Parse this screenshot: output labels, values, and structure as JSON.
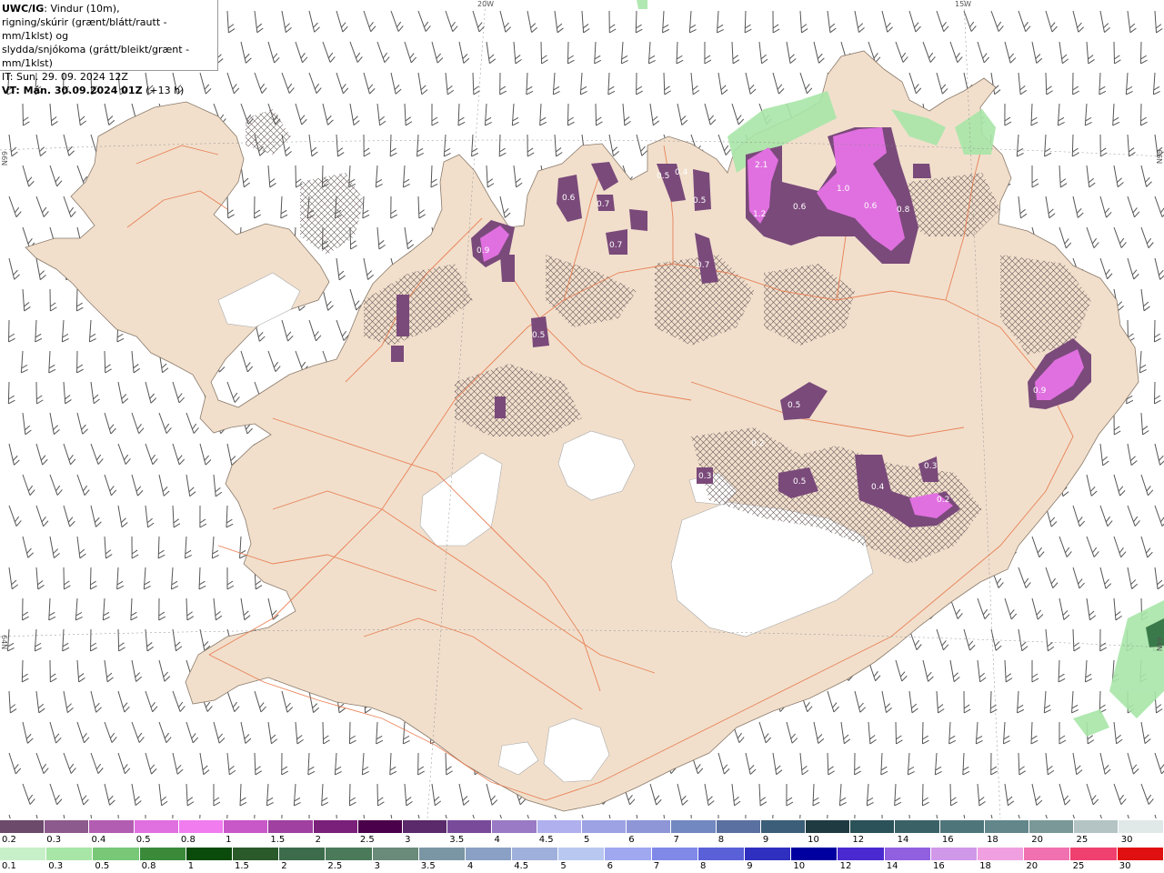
{
  "header": {
    "model": "UWC/IG",
    "line1_rest": ": Vindur (10m),",
    "line2": "rigning/skúrir (grænt/blátt/rautt - mm/1klst) og",
    "line3": "slydda/snjókoma (grátt/bleikt/grænt - mm/1klst)",
    "it": "IT: Sun. 29. 09. 2024 12Z",
    "vt_label": "VT: Mán. 30.09.2024 01Z",
    "vt_offset": "(+13 h)"
  },
  "grid_labels": {
    "lon_20w": "20W",
    "lon_15w": "15W",
    "lat_66n_left": "66N",
    "lat_66n_right": "66N",
    "lat_64n_left": "64N",
    "lat_64n_right": "64N"
  },
  "snow_legend": {
    "labels": [
      "0.2",
      "0.3",
      "0.4",
      "0.5",
      "0.8",
      "1",
      "1.5",
      "2",
      "2.5",
      "3",
      "3.5",
      "4",
      "4.5",
      "5",
      "6",
      "7",
      "8",
      "9",
      "10",
      "12",
      "14",
      "16",
      "18",
      "20",
      "25",
      "30"
    ],
    "colors": [
      "#6b4a6b",
      "#8c5a8c",
      "#b25cb2",
      "#e070e0",
      "#f07cf0",
      "#c858c8",
      "#a040a0",
      "#7a1f7a",
      "#4a004a",
      "#5a2a6a",
      "#7a4a9a",
      "#9a7ac4",
      "#b0b0ee",
      "#9da2e4",
      "#8e96d8",
      "#7288c0",
      "#5a70a0",
      "#3c5e78",
      "#1f3a40",
      "#2a5258",
      "#3a6266",
      "#4e767a",
      "#62868a",
      "#7a9898",
      "#b4c4c4",
      "#e0e8e8"
    ]
  },
  "rain_legend": {
    "labels": [
      "0.1",
      "0.3",
      "0.5",
      "0.8",
      "1",
      "1.5",
      "2",
      "2.5",
      "3",
      "3.5",
      "4",
      "4.5",
      "5",
      "6",
      "7",
      "8",
      "9",
      "10",
      "12",
      "14",
      "16",
      "18",
      "20",
      "25",
      "30"
    ],
    "colors": [
      "#c8f0c8",
      "#a8e6a8",
      "#78c878",
      "#3a8a3a",
      "#0a4a0a",
      "#2a5a2a",
      "#3c6c4c",
      "#4a7a5a",
      "#6a8a7a",
      "#7a96a4",
      "#8aa0c4",
      "#a0b0dc",
      "#b8c8f0",
      "#a0a8f0",
      "#8088e8",
      "#5a60d8",
      "#3030c0",
      "#0000a0",
      "#4a2ad0",
      "#9060e0",
      "#d098e8",
      "#f0a0e0",
      "#f070b0",
      "#f04070",
      "#e01010"
    ]
  },
  "precip_labels": [
    {
      "text": "2.1",
      "pos": "nw-cluster"
    },
    {
      "text": "1.2",
      "pos": "nw-cluster"
    },
    {
      "text": "0.6",
      "pos": "ne"
    },
    {
      "text": "1.0",
      "pos": "ne"
    },
    {
      "text": "0.6",
      "pos": "ne"
    },
    {
      "text": "0.8",
      "pos": "ne"
    },
    {
      "text": "0.9",
      "pos": "east"
    },
    {
      "text": "0.5",
      "pos": "central"
    },
    {
      "text": "0.5",
      "pos": "south-central"
    },
    {
      "text": "0.4",
      "pos": "south-east"
    },
    {
      "text": "0.3",
      "pos": "south-east"
    },
    {
      "text": "0.3",
      "pos": "south-central"
    },
    {
      "text": "0.2",
      "pos": "south-east"
    },
    {
      "text": "0.5",
      "pos": "north-central"
    },
    {
      "text": "0.6",
      "pos": "north"
    },
    {
      "text": "0.7",
      "pos": "north"
    },
    {
      "text": "0.7",
      "pos": "north"
    },
    {
      "text": "0.5",
      "pos": "north"
    },
    {
      "text": "0.4",
      "pos": "north"
    },
    {
      "text": "0.5",
      "pos": "north"
    },
    {
      "text": "0.7",
      "pos": "north"
    },
    {
      "text": "0.9",
      "pos": "westfjords"
    },
    {
      "text": "0.2",
      "pos": "central-east"
    }
  ],
  "colors": {
    "land": "#f1dfcc",
    "sea": "#ffffff",
    "glacier": "#ffffff",
    "roads": "#e8784a",
    "wind": "#555555",
    "snow_heavy": "#e070e0",
    "snow_light": "#7a4a7a",
    "rain": "#a8e6a8"
  }
}
